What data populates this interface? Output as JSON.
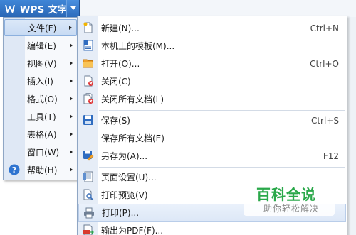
{
  "app": {
    "title": "WPS 文字"
  },
  "main_menu": {
    "items": [
      {
        "label": "文件(F)",
        "icon": "file-menu-icon",
        "active": true
      },
      {
        "label": "编辑(E)"
      },
      {
        "label": "视图(V)"
      },
      {
        "label": "插入(I)"
      },
      {
        "label": "格式(O)"
      },
      {
        "label": "工具(T)"
      },
      {
        "label": "表格(A)"
      },
      {
        "label": "窗口(W)"
      },
      {
        "label": "帮助(H)",
        "icon": "help-icon"
      }
    ]
  },
  "file_menu": {
    "items": [
      {
        "label": "新建(N)...",
        "shortcut": "Ctrl+N",
        "icon": "new-document-icon"
      },
      {
        "label": "本机上的模板(M)...",
        "shortcut": "",
        "icon": "template-icon"
      },
      {
        "label": "打开(O)...",
        "shortcut": "Ctrl+O",
        "icon": "open-folder-icon"
      },
      {
        "label": "关闭(C)",
        "shortcut": "",
        "icon": "close-document-icon"
      },
      {
        "label": "关闭所有文档(L)",
        "shortcut": "",
        "icon": "close-all-documents-icon"
      },
      {
        "label": "保存(S)",
        "shortcut": "Ctrl+S",
        "icon": "save-icon"
      },
      {
        "label": "保存所有文档(E)",
        "shortcut": "",
        "icon": ""
      },
      {
        "label": "另存为(A)...",
        "shortcut": "F12",
        "icon": "save-as-icon"
      },
      {
        "label": "页面设置(U)...",
        "shortcut": "",
        "icon": "page-setup-icon"
      },
      {
        "label": "打印预览(V)",
        "shortcut": "",
        "icon": "print-preview-icon"
      },
      {
        "label": "打印(P)...",
        "shortcut": "",
        "icon": "print-icon",
        "hover": true
      },
      {
        "label": "输出为PDF(F)...",
        "shortcut": "",
        "icon": "export-pdf-icon"
      }
    ]
  },
  "watermark": {
    "title": "百科全说",
    "subtitle": "助你轻松解决"
  },
  "colors": {
    "titlebar": "#2a67b6",
    "menu_border": "#8fa6c4",
    "watermark_green": "#2aa84a"
  }
}
